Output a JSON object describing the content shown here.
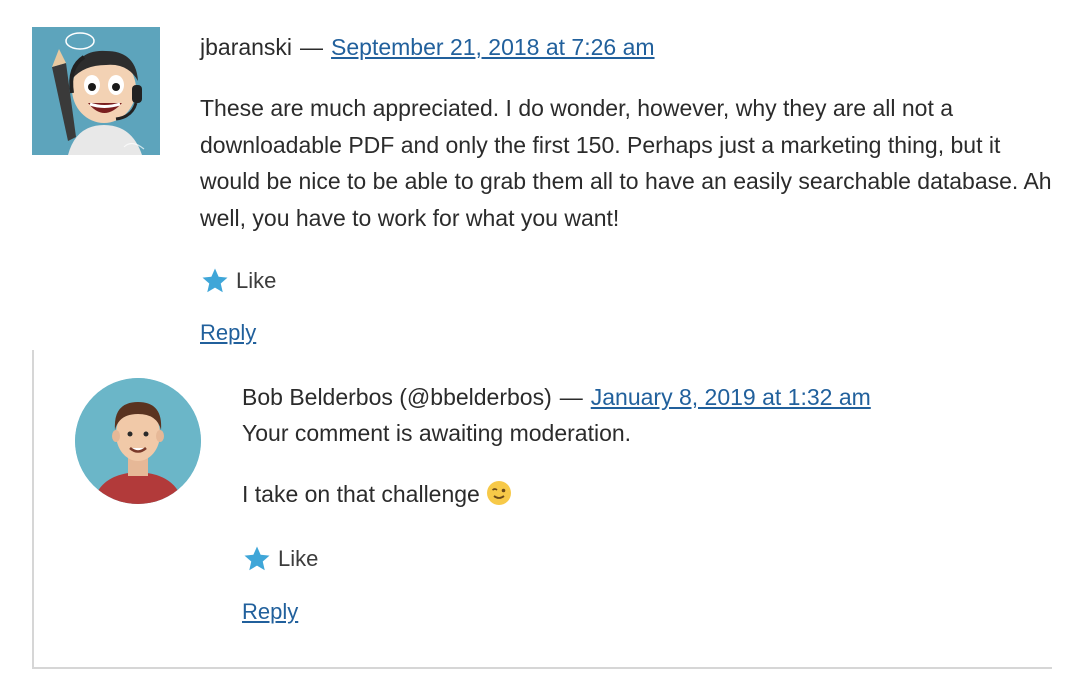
{
  "comments": [
    {
      "author": "jbaranski",
      "date": "September 21, 2018 at 7:26 am",
      "separator": "—",
      "text": "These are much appreciated. I do wonder, however, why they are all not a downloadable PDF and only the first 150. Perhaps just a marketing thing, but it would be nice to be able to grab them all to have an easily searchable database. Ah well, you have to work for what you want!",
      "like_label": "Like",
      "reply_label": "Reply",
      "avatar_icon": "cartoon-avatar-icon"
    },
    {
      "author": "Bob Belderbos (@bbelderbos)",
      "date": "January 8, 2019 at 1:32 am",
      "separator": "—",
      "moderation": "Your comment is awaiting moderation.",
      "text": "I take on that challenge",
      "emoji": "winking-face-icon",
      "like_label": "Like",
      "reply_label": "Reply",
      "avatar_icon": "person-avatar-icon"
    }
  ],
  "colors": {
    "link": "#21609c",
    "star": "#3fa6d8",
    "border": "#d6d6d6",
    "avatar_bg_1": "#5da4bc",
    "avatar_bg_2": "#6bb6c8"
  }
}
